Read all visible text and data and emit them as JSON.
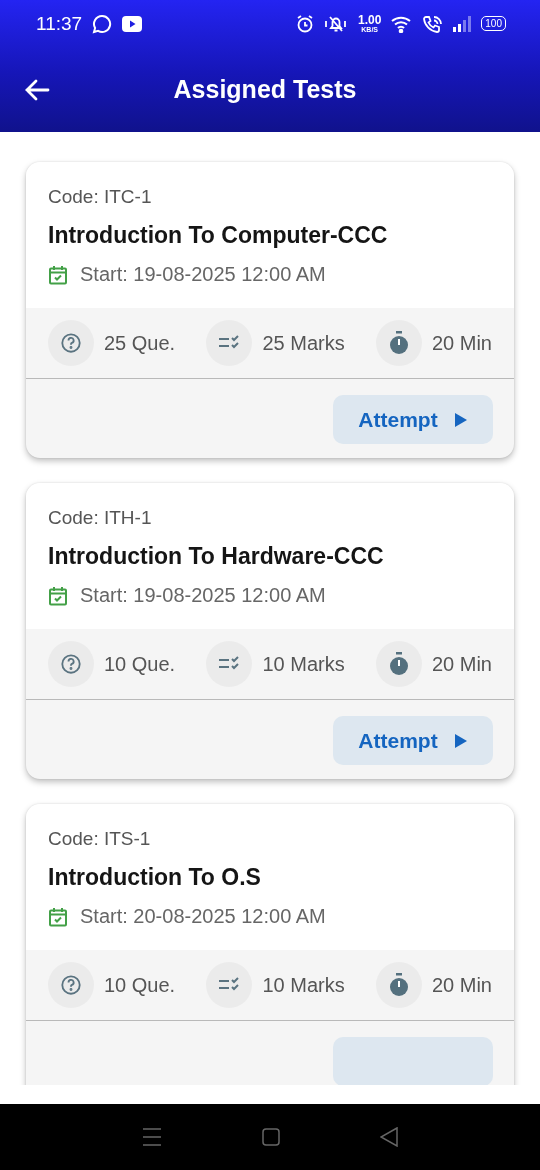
{
  "status_bar": {
    "time": "11:37",
    "net_speed": "1.00",
    "net_unit": "KB/S",
    "battery": "100"
  },
  "app_bar": {
    "title": "Assigned Tests"
  },
  "tests": [
    {
      "code": "Code: ITC-1",
      "title": "Introduction To Computer-CCC",
      "start": "Start: 19-08-2025 12:00 AM",
      "questions": "25 Que.",
      "marks": "25 Marks",
      "duration": "20 Min",
      "action": "Attempt"
    },
    {
      "code": "Code: ITH-1",
      "title": "Introduction To Hardware-CCC",
      "start": "Start: 19-08-2025 12:00 AM",
      "questions": "10 Que.",
      "marks": "10 Marks",
      "duration": "20 Min",
      "action": "Attempt"
    },
    {
      "code": "Code: ITS-1",
      "title": "Introduction To O.S",
      "start": "Start: 20-08-2025 12:00 AM",
      "questions": "10 Que.",
      "marks": "10 Marks",
      "duration": "20 Min"
    }
  ]
}
